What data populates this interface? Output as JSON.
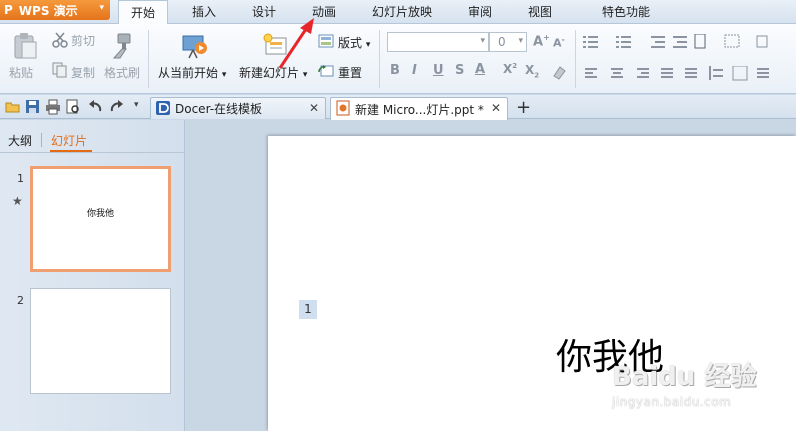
{
  "app": {
    "logo_text": "P",
    "name": "WPS 演示",
    "caret": "▾"
  },
  "menu": {
    "items": [
      {
        "label": "开始"
      },
      {
        "label": "插入"
      },
      {
        "label": "设计"
      },
      {
        "label": "动画"
      },
      {
        "label": "幻灯片放映"
      },
      {
        "label": "审阅"
      },
      {
        "label": "视图"
      },
      {
        "label": "特色功能"
      }
    ],
    "active": "开始"
  },
  "ribbon": {
    "paste": "粘贴",
    "cut": "剪切",
    "copy": "复制",
    "format_painter": "格式刷",
    "from_current": "从当前开始",
    "new_slide": "新建幻灯片",
    "layout": "版式",
    "reset": "重置",
    "font_size": "0",
    "caret": "▾"
  },
  "tabs": [
    {
      "label": "Docer-在线模板",
      "close": "✕"
    },
    {
      "label": "新建 Micro...灯片.ppt *",
      "close": "✕"
    }
  ],
  "new_tab": "+",
  "left_pane": {
    "tab_outline": "大纲",
    "tab_slides": "幻灯片",
    "thumbnails": [
      {
        "number": "1",
        "text": "你我他"
      },
      {
        "number": "2",
        "text": ""
      }
    ]
  },
  "slide": {
    "title": "你我他",
    "placeholder_number": "1"
  },
  "watermark": {
    "text": "Baidu 经验",
    "url": "jingyan.baidu.com"
  },
  "colors": {
    "accent": "#e26c16",
    "app_orange": "#f08a2e",
    "arrow_red": "#e8262a"
  }
}
